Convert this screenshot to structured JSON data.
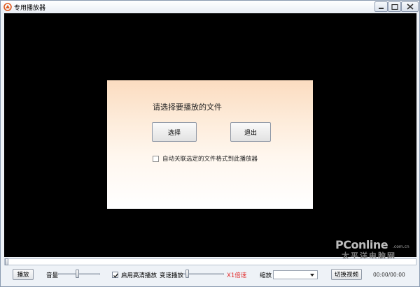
{
  "window": {
    "title": "专用播放器",
    "accent": "#e05a1e"
  },
  "dialog": {
    "prompt": "请选择要播放的文件",
    "select_label": "选择",
    "exit_label": "退出",
    "associate_label": "自动关联选定的文件格式到此播放器",
    "associate_checked": false
  },
  "watermark": {
    "brand": "PConline",
    "domain": ".com.cn",
    "subtitle": "太平洋电脑网"
  },
  "controls": {
    "play_label": "播放",
    "volume_label": "音量",
    "volume_level": 0.45,
    "hd_label": "启用高清播放",
    "hd_checked": true,
    "speed_label": "变速播放",
    "speed_level": 0.05,
    "speed_value": "X1倍速",
    "zoom_label": "缩放",
    "zoom_value": "",
    "switch_label": "切换视频",
    "time": "00:00/00:00",
    "seek_position": 0,
    "speed_color": "#e22b2b"
  }
}
